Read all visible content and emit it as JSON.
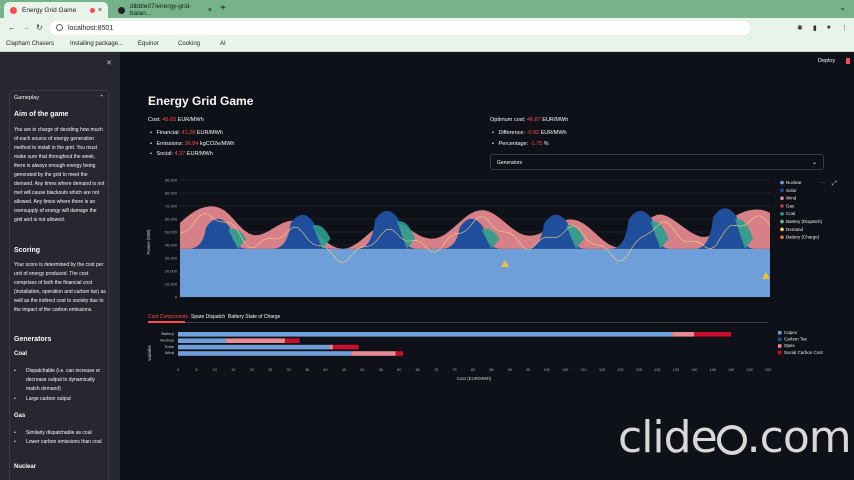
{
  "browser": {
    "tabs": [
      {
        "label": "Energy Grid Game"
      },
      {
        "label": "dibble07/energy-grid-balan..."
      }
    ],
    "url": "localhost:8501",
    "bookmarks": [
      "Clapham Chasers",
      "Installing package...",
      "Equinor",
      "Cooking",
      "AI"
    ]
  },
  "header": {
    "deploy": "Deploy"
  },
  "sidebar": {
    "expander_label": "Gameplay",
    "aim_title": "Aim of the game",
    "aim_text": "You are in charge of deciding how much of each source of energy generation method to install in the grid. You must make sure that throughout the week, there is always enough energy being generated by the grid to meet the demand. Any times where demand is not met will cause blackouts which are not allowed. Any times where there is an oversupply of energy will damage the grid and is not allowed.",
    "scoring_title": "Scoring",
    "scoring_text": "Your score is determined by the cost per unit of energy produced. The cost comprises of both the financial cost (installation, operation and carbon tax) as well as the indirect cost to society due to the impact of the carbon emissions.",
    "generators_title": "Generators",
    "coal_title": "Coal",
    "coal_items": [
      "Dispatchable (i.e. can increase or decrease output to dynamically match demand)",
      "Large carbon output"
    ],
    "gas_title": "Gas",
    "gas_items": [
      "Similarly dispatchable as coal",
      "Lower carbon emissions than coal"
    ],
    "nuclear_title": "Nuclear"
  },
  "main": {
    "title": "Energy Grid Game",
    "cost_label": "Cost:",
    "cost_value": "45.65",
    "cost_unit": "EUR/MWh",
    "financial_label": "Financial:",
    "financial_value": "41.28",
    "financial_unit": "EUR/MWh",
    "emissions_label": "Emissions:",
    "emissions_value": "36.84",
    "emissions_unit": "kgCO2e/MWh",
    "social_label": "Social:",
    "social_value": "4.37",
    "social_unit": "EUR/MWh",
    "optimum_label": "Optimum cost:",
    "optimum_value": "46.87",
    "optimum_unit": "EUR/MWh",
    "difference_label": "Difference:",
    "difference_value": "-0.82",
    "difference_unit": "EUR/MWh",
    "percentage_label": "Percentage:",
    "percentage_value": "-1.75",
    "percentage_unit": "%",
    "select_label": "Generators",
    "lower_tabs": [
      "Cost Components",
      "Spare Dispatch",
      "Battery State of Charge"
    ]
  },
  "colors": {
    "accent": "#ff4b4b",
    "nuclear": "#6f9fd8",
    "solar": "#1f4f9c",
    "wind": "#e88a93",
    "gas": "#c43b3b",
    "coal": "#2a9d8f",
    "battery_dispatch": "#5cc08a",
    "demand": "#f2d27a",
    "battery_charge": "#e5734a",
    "capex": "#6f9fd8",
    "carbon_tax": "#1f4f9c",
    "opex": "#e88a93",
    "social_carbon": "#c8102e"
  },
  "chart_data": [
    {
      "type": "area",
      "xlabel": "",
      "ylabel": "Power (MW)",
      "x": [
        "Tue 03",
        "Wed 04",
        "Thu 05",
        "Fri 06",
        "Sat 07",
        "Oct 08",
        "Mon 09"
      ],
      "ylim": [
        0,
        90000
      ],
      "yticks": [
        "0",
        "10,000",
        "20,000",
        "30,000",
        "40,000",
        "50,000",
        "60,000",
        "70,000",
        "80,000",
        "90,000"
      ],
      "legend": [
        "Nuclear",
        "Solar",
        "Wind",
        "Gas",
        "Coal",
        "Battery (Dispatch)",
        "Demand",
        "Battery (Charge)"
      ],
      "legend_position": "right",
      "series": [
        {
          "name": "Nuclear",
          "values": [
            37000,
            37000,
            37000,
            37000,
            37000,
            37000,
            37000
          ]
        },
        {
          "name": "Demand",
          "values": [
            55000,
            52000,
            58000,
            50000,
            56000,
            54000,
            48000
          ]
        }
      ]
    },
    {
      "type": "bar",
      "orientation": "horizontal",
      "ylabel": "variable",
      "xlabel": "Cost (EUR/MWh)",
      "categories": [
        "Battery",
        "Nuclear",
        "Solar",
        "Wind"
      ],
      "xticks": [
        "0",
        "5",
        "10",
        "15",
        "20",
        "25",
        "30",
        "35",
        "40",
        "45",
        "50",
        "55",
        "60",
        "65",
        "70",
        "75",
        "80",
        "85",
        "90",
        "95",
        "100",
        "105",
        "110",
        "115",
        "120",
        "125",
        "130",
        "135",
        "140",
        "145",
        "150",
        "155",
        "160"
      ],
      "xlim": [
        0,
        160
      ],
      "legend": [
        "Capex",
        "Carbon Tax",
        "Opex",
        "Social Carbon Cost"
      ],
      "series": [
        {
          "name": "Capex",
          "values": [
            134,
            13,
            41,
            47
          ]
        },
        {
          "name": "Opex",
          "values": [
            6,
            16,
            1,
            12
          ]
        },
        {
          "name": "Social Carbon Cost",
          "values": [
            10,
            4,
            7,
            2
          ]
        }
      ]
    }
  ],
  "watermark": "clideo.com"
}
